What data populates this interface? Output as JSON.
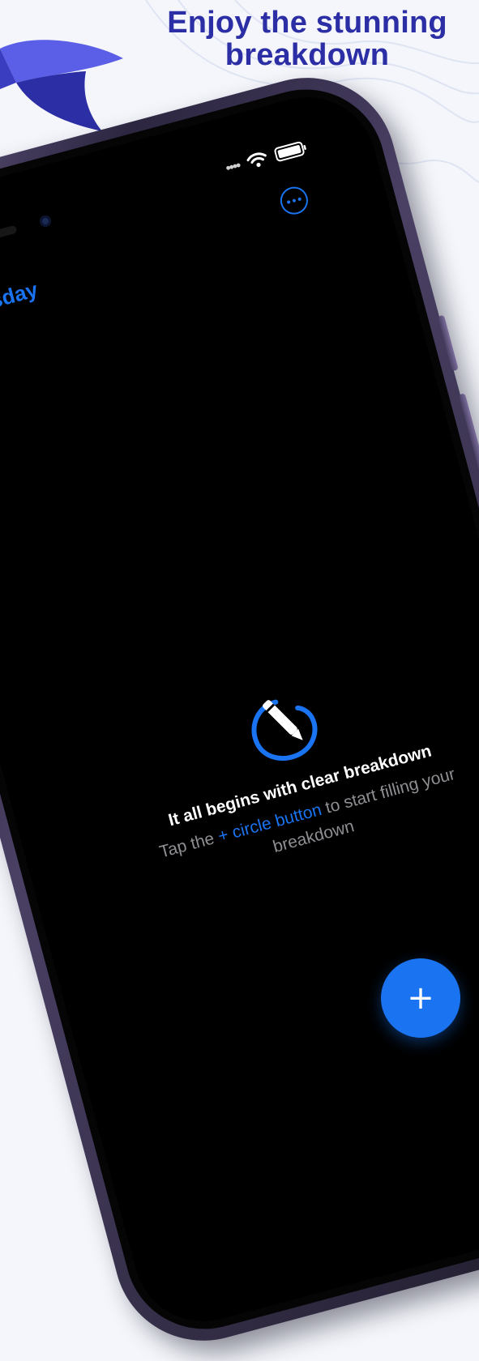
{
  "headline": {
    "line1": "Enjoy the stunning",
    "line2": "breakdown"
  },
  "colors": {
    "accent": "#1a73f0",
    "headline": "#2b2ea4",
    "logo_light": "#5b5ee6",
    "logo_dark": "#2b2ea4"
  },
  "status_bar": {
    "signal_dots": "••••",
    "icons": [
      "wifi-icon",
      "battery-icon"
    ]
  },
  "nav": {
    "title": "ible Tuesday",
    "more_icon": "ellipsis-circle-icon"
  },
  "empty_state": {
    "icon": "pencil-circle-icon",
    "title": "It all begins with clear breakdown",
    "subtitle_prefix": "Tap the ",
    "subtitle_link": "+ circle button",
    "subtitle_suffix": " to start filling your breakdown"
  },
  "fab": {
    "label": "+"
  }
}
